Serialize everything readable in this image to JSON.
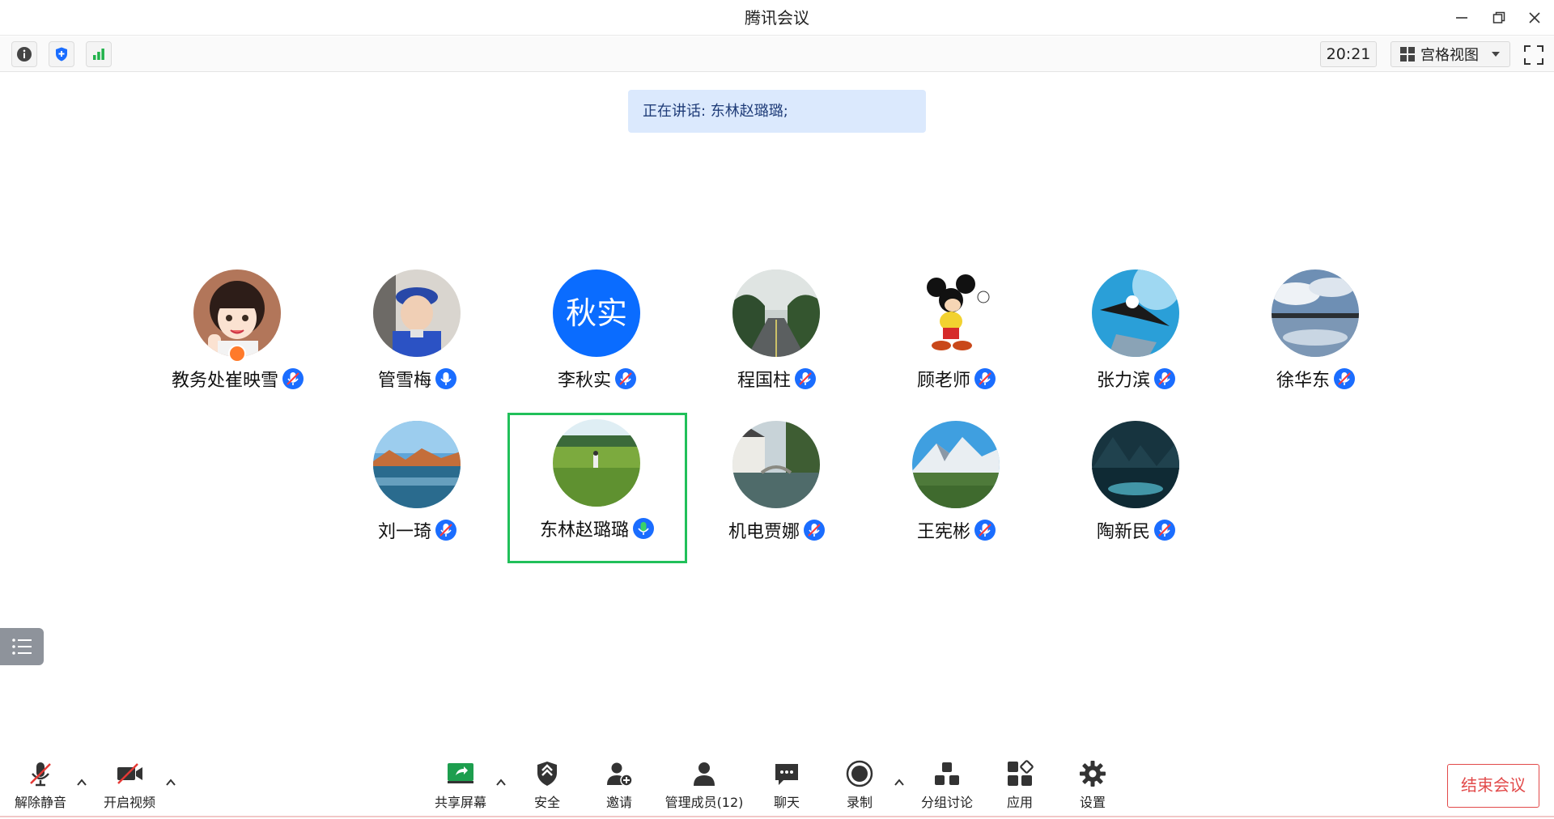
{
  "window": {
    "title": "腾讯会议"
  },
  "toolbar": {
    "time": "20:21",
    "view_label": "宫格视图"
  },
  "speaking": {
    "text": "正在讲话: 东林赵璐璐;"
  },
  "participants": [
    {
      "name": "教务处崔映雪",
      "avatar": "anime-girl",
      "mic": "muted",
      "host": true
    },
    {
      "name": "管雪梅",
      "avatar": "child-photo",
      "mic": "on"
    },
    {
      "name": "李秋实",
      "avatar": "text-initials",
      "initials": "秋实",
      "mic": "muted"
    },
    {
      "name": "程国柱",
      "avatar": "road-photo",
      "mic": "muted"
    },
    {
      "name": "顾老师",
      "avatar": "mickey",
      "mic": "muted"
    },
    {
      "name": "张力滨",
      "avatar": "eagle",
      "mic": "muted"
    },
    {
      "name": "徐华东",
      "avatar": "sky-lake",
      "mic": "muted"
    },
    {
      "name": "刘一琦",
      "avatar": "lake-sunset",
      "mic": "muted"
    },
    {
      "name": "东林赵璐璐",
      "avatar": "green-field",
      "mic": "speaking",
      "active": true
    },
    {
      "name": "机电贾娜",
      "avatar": "canal-town",
      "mic": "muted"
    },
    {
      "name": "王宪彬",
      "avatar": "mountain",
      "mic": "muted"
    },
    {
      "name": "陶新民",
      "avatar": "mountain-lake",
      "mic": "muted"
    }
  ],
  "bottom": {
    "unmute": "解除静音",
    "video": "开启视频",
    "share": "共享屏幕",
    "security": "安全",
    "invite": "邀请",
    "members": "管理成员(12)",
    "chat": "聊天",
    "record": "录制",
    "breakout": "分组讨论",
    "apps": "应用",
    "settings": "设置",
    "end": "结束会议"
  },
  "colors": {
    "accent": "#0a6cff",
    "active_border": "#21c05a",
    "end_red": "#e24a4a",
    "banner_bg": "#dbe9fd"
  }
}
